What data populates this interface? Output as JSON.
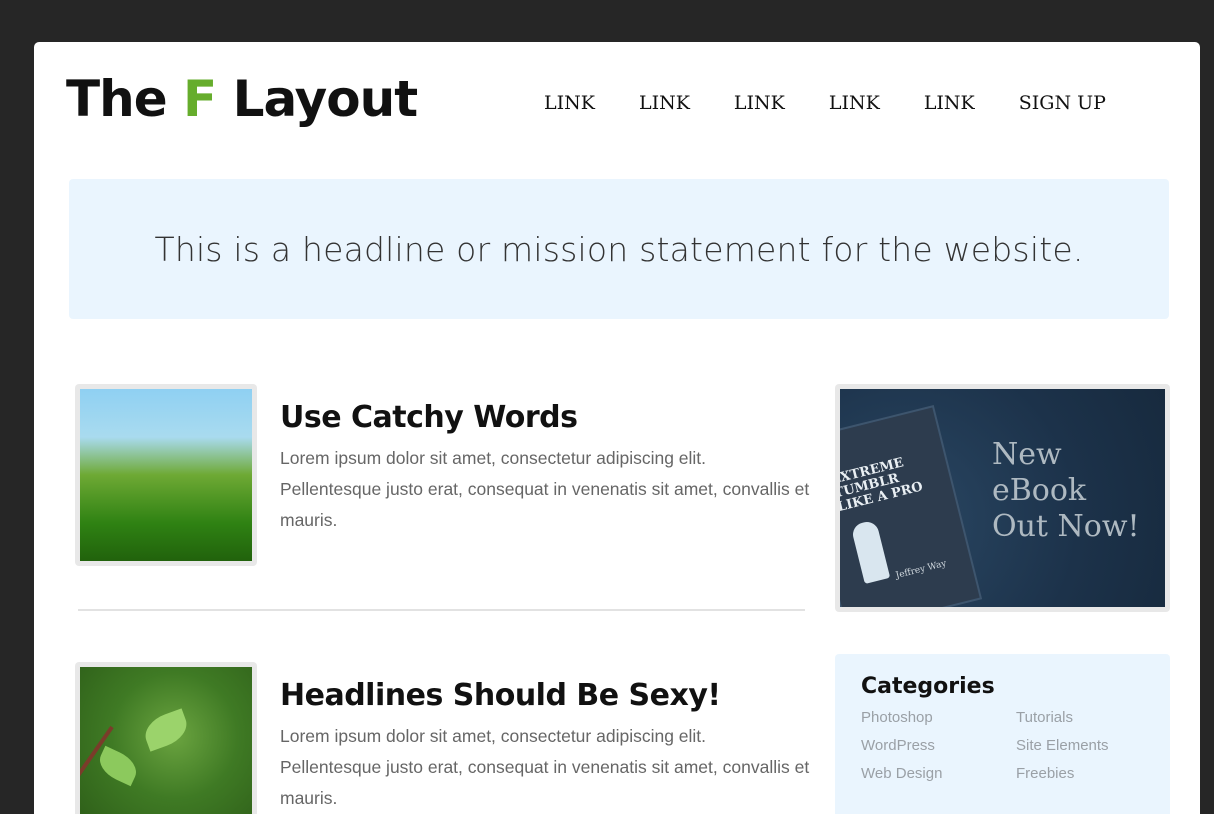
{
  "logo": {
    "prefix": "The ",
    "accent": "F",
    "suffix": " Layout"
  },
  "nav": {
    "links": [
      "LINK",
      "LINK",
      "LINK",
      "LINK",
      "LINK"
    ],
    "signup": "SIGN UP"
  },
  "hero": {
    "headline": "This is a headline or mission statement for the website."
  },
  "articles": [
    {
      "title": "Use Catchy Words",
      "body": "Lorem ipsum dolor sit amet, consectetur adipiscing elit. Pellentesque justo erat, consequat in venenatis sit amet, convallis et mauris."
    },
    {
      "title": "Headlines Should Be Sexy!",
      "body": "Lorem ipsum dolor sit amet, consectetur adipiscing elit. Pellentesque justo erat, consequat in venenatis sit amet, convallis et mauris."
    }
  ],
  "ad": {
    "book_title": "EXTREME TUMBLR LIKE A PRO",
    "book_author": "Jeffrey Way",
    "lines": [
      "New",
      "eBook",
      "Out Now!"
    ]
  },
  "categories": {
    "title": "Categories",
    "items": [
      "Photoshop",
      "Tutorials",
      "WordPress",
      "Site Elements",
      "Web Design",
      "Freebies"
    ]
  },
  "colors": {
    "accent": "#66ad2c",
    "frame": "#262626",
    "hero_bg": "#eaf5fe"
  }
}
